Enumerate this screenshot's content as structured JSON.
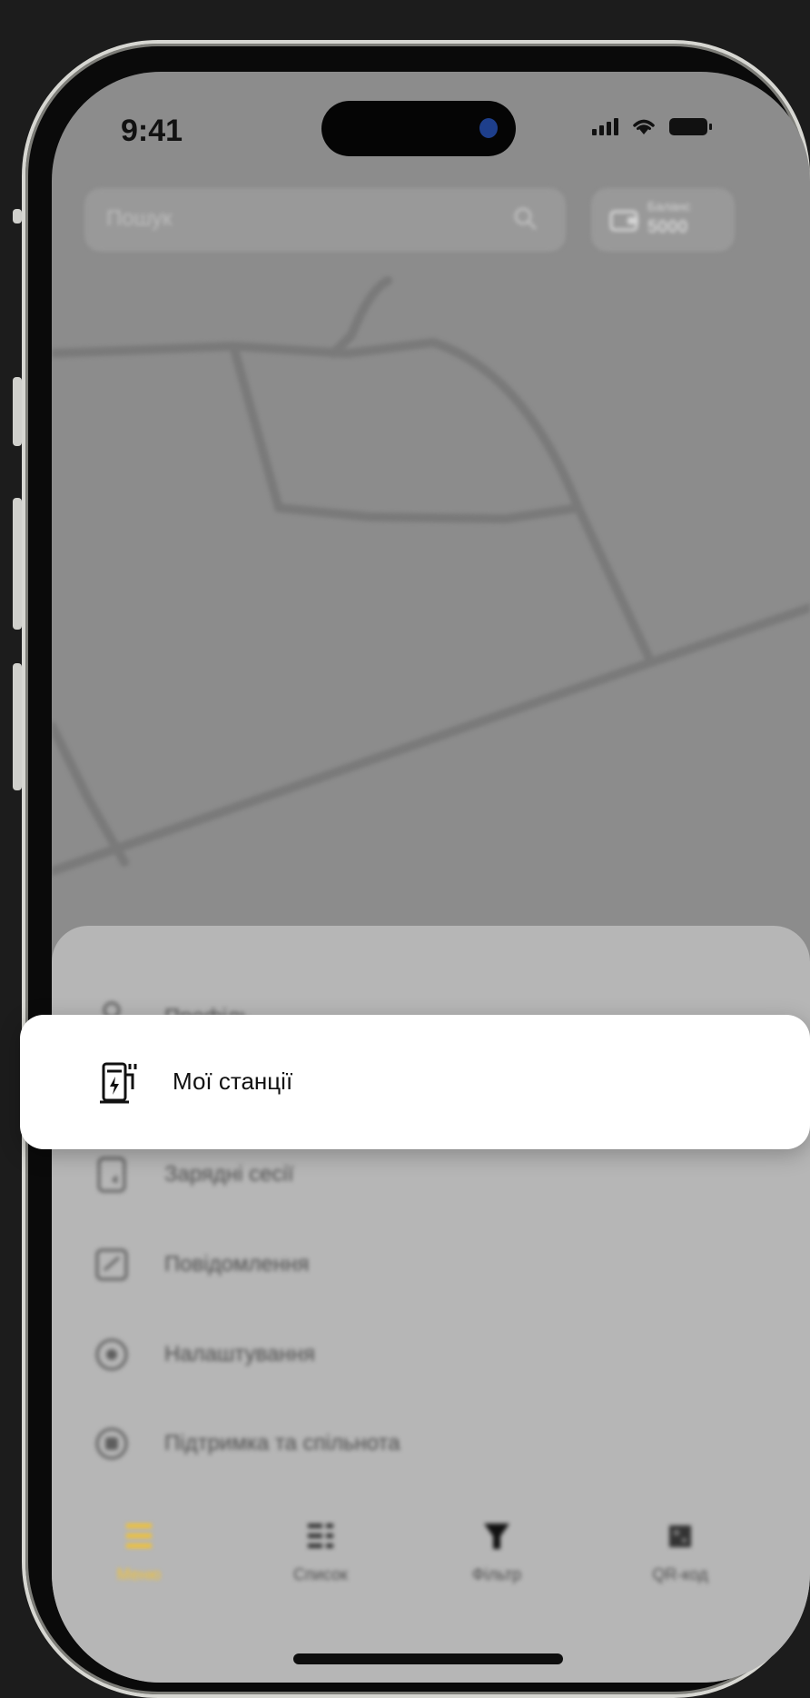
{
  "status_bar": {
    "time": "9:41"
  },
  "search": {
    "placeholder": "Пошук"
  },
  "balance": {
    "label": "Баланс",
    "value": "5000"
  },
  "menu": {
    "items": [
      {
        "label": "Профіль",
        "icon": "user-icon"
      },
      {
        "label": "Мої станції",
        "icon": "charging-station-icon",
        "highlighted": true
      },
      {
        "label": "Зарядні сесії",
        "icon": "document-icon"
      },
      {
        "label": "Повідомлення",
        "icon": "notification-icon"
      },
      {
        "label": "Налаштування",
        "icon": "settings-icon"
      },
      {
        "label": "Підтримка та спільнота",
        "icon": "support-icon"
      }
    ]
  },
  "bottom_nav": {
    "items": [
      {
        "label": "Меню",
        "icon": "menu-icon",
        "active": true
      },
      {
        "label": "Список",
        "icon": "list-icon"
      },
      {
        "label": "Фільтр",
        "icon": "filter-icon"
      },
      {
        "label": "QR-код",
        "icon": "qr-code-icon"
      }
    ]
  },
  "colors": {
    "accent": "#f2c232",
    "card": "#ffffff",
    "overlay": "#8c8c8c",
    "background": "#1c1c1c"
  }
}
